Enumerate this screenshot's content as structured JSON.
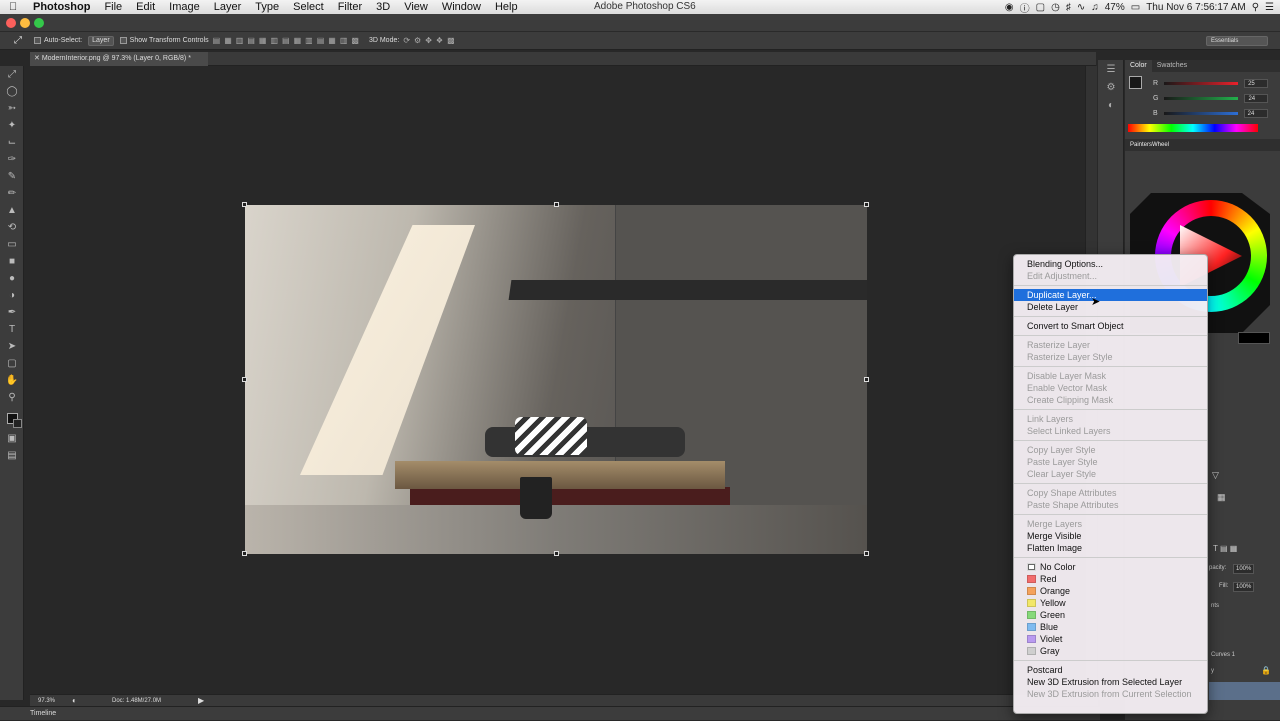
{
  "menubar": {
    "app": "Photoshop",
    "items": [
      "File",
      "Edit",
      "Image",
      "Layer",
      "Type",
      "Select",
      "Filter",
      "3D",
      "View",
      "Window",
      "Help"
    ],
    "window_title": "Adobe Photoshop CS6",
    "battery": "47%",
    "datetime": "Thu Nov 6  7:56:17 AM"
  },
  "options_bar": {
    "auto_select_label": "Auto-Select:",
    "auto_select_value": "Layer",
    "transform_label": "Show Transform Controls",
    "mode_label": "3D Mode:",
    "workspace": "Essentials"
  },
  "document": {
    "tab_label": "ModernInterior.png @ 97.3% (Layer 0, RGB/8) *"
  },
  "status": {
    "zoom": "97.3%",
    "doc_info": "Doc: 1.48M/27.0M"
  },
  "timeline_label": "Timeline",
  "color_panel": {
    "tabs": [
      "Color",
      "Swatches"
    ],
    "r_label": "R",
    "r_value": "25",
    "g_label": "G",
    "g_value": "24",
    "b_label": "B",
    "b_value": "24",
    "colors": {
      "r_track": "#e8212b",
      "g_track": "#22b14c",
      "b_track": "#2d6fd6"
    }
  },
  "wheel_panel": {
    "title": "PaintersWheel"
  },
  "layers_panel": {
    "opacity_label": "pacity:",
    "opacity_value": "100%",
    "fill_label": "Fill:",
    "fill_value": "100%",
    "row1": "nts",
    "row2": "Curves 1",
    "row3": "y"
  },
  "context_menu": {
    "groups": [
      [
        {
          "label": "Blending Options...",
          "enabled": true
        },
        {
          "label": "Edit Adjustment...",
          "enabled": false
        }
      ],
      [
        {
          "label": "Duplicate Layer...",
          "enabled": true,
          "highlighted": true
        },
        {
          "label": "Delete Layer",
          "enabled": true
        }
      ],
      [
        {
          "label": "Convert to Smart Object",
          "enabled": true
        }
      ],
      [
        {
          "label": "Rasterize Layer",
          "enabled": false
        },
        {
          "label": "Rasterize Layer Style",
          "enabled": false
        }
      ],
      [
        {
          "label": "Disable Layer Mask",
          "enabled": false
        },
        {
          "label": "Enable Vector Mask",
          "enabled": false
        },
        {
          "label": "Create Clipping Mask",
          "enabled": false
        }
      ],
      [
        {
          "label": "Link Layers",
          "enabled": false
        },
        {
          "label": "Select Linked Layers",
          "enabled": false
        }
      ],
      [
        {
          "label": "Copy Layer Style",
          "enabled": false
        },
        {
          "label": "Paste Layer Style",
          "enabled": false
        },
        {
          "label": "Clear Layer Style",
          "enabled": false
        }
      ],
      [
        {
          "label": "Copy Shape Attributes",
          "enabled": false
        },
        {
          "label": "Paste Shape Attributes",
          "enabled": false
        }
      ],
      [
        {
          "label": "Merge Layers",
          "enabled": false
        },
        {
          "label": "Merge Visible",
          "enabled": true
        },
        {
          "label": "Flatten Image",
          "enabled": true
        }
      ],
      [
        {
          "label": "No Color",
          "enabled": true,
          "swatch": "none"
        },
        {
          "label": "Red",
          "enabled": true,
          "swatch": "#f26c6c"
        },
        {
          "label": "Orange",
          "enabled": true,
          "swatch": "#f5a25c"
        },
        {
          "label": "Yellow",
          "enabled": true,
          "swatch": "#f2e768"
        },
        {
          "label": "Green",
          "enabled": true,
          "swatch": "#86d97a"
        },
        {
          "label": "Blue",
          "enabled": true,
          "swatch": "#7fbbf0"
        },
        {
          "label": "Violet",
          "enabled": true,
          "swatch": "#b99af0"
        },
        {
          "label": "Gray",
          "enabled": true,
          "swatch": "#cfcfcf"
        }
      ],
      [
        {
          "label": "Postcard",
          "enabled": true
        },
        {
          "label": "New 3D Extrusion from Selected Layer",
          "enabled": true
        },
        {
          "label": "New 3D Extrusion from Current Selection",
          "enabled": false
        }
      ]
    ]
  },
  "icons": {
    "apple": "apple-icon",
    "move": "move-tool-icon",
    "wifi": "wifi-icon"
  }
}
